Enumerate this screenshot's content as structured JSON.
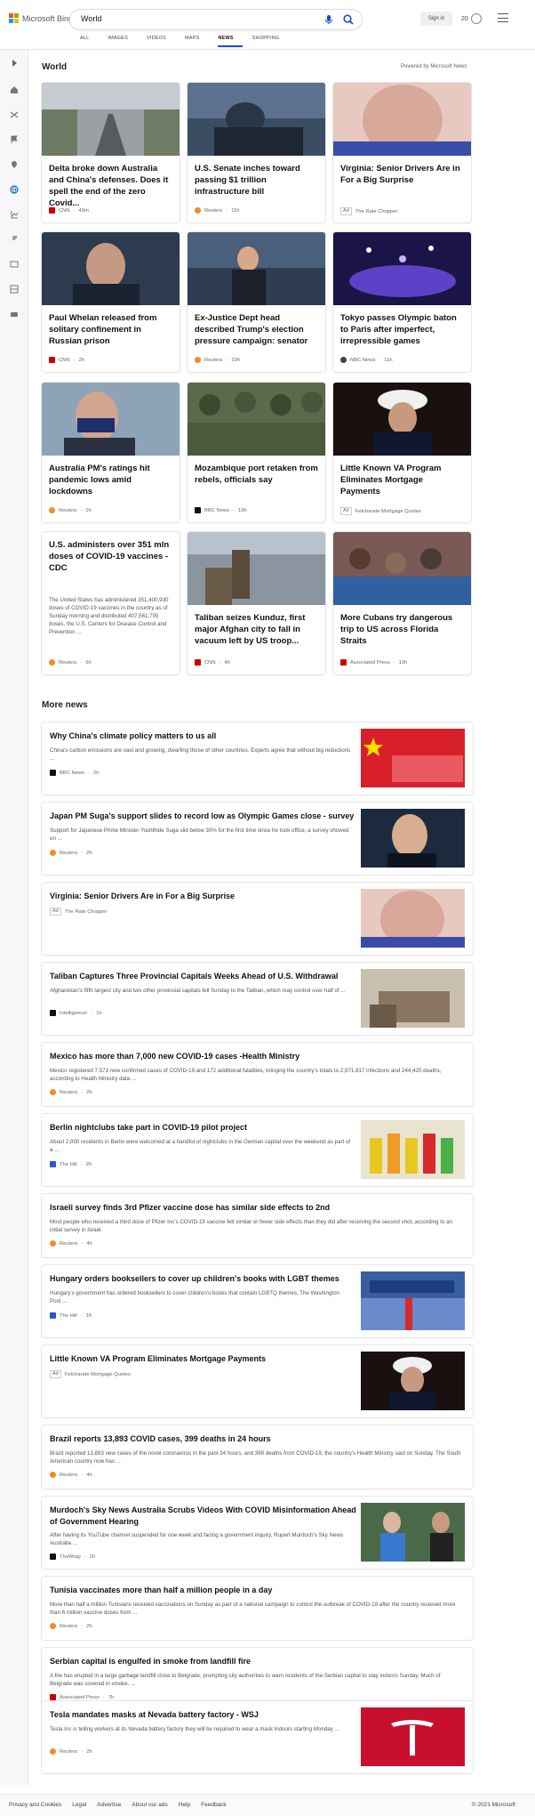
{
  "header": {
    "brand": "Microsoft Bing",
    "query": "World",
    "sign_in": "Sign in",
    "rewards_count": "20",
    "scopes": [
      "ALL",
      "IMAGES",
      "VIDEOS",
      "MAPS",
      "NEWS",
      "SHOPPING"
    ],
    "active_scope": "NEWS"
  },
  "colors": {
    "accent": "#174ae4",
    "brand_red": "#f25022",
    "brand_green": "#7fba00",
    "brand_blue": "#00a4ef",
    "brand_yellow": "#ffb900"
  },
  "rail_icons": [
    "expand-icon",
    "home-icon",
    "shuffle-icon",
    "flag-icon",
    "location-icon",
    "globe-icon",
    "business-icon",
    "rocket-icon",
    "entertainment-icon",
    "sports-icon",
    "car-icon"
  ],
  "world": {
    "title": "World",
    "powered_by": "Powered by Microsoft News",
    "cards": [
      {
        "title": "Delta broke down Australia and China's defenses. Does it spell the end of the zero Covid...",
        "source": "CNN",
        "time": "45m",
        "ad": false
      },
      {
        "title": "U.S. Senate inches toward passing $1 trillion infrastructure bill",
        "source": "Reuters",
        "time": "11h",
        "ad": false
      },
      {
        "title": "Virginia: Senior Drivers Are in For a Big Surprise",
        "source": "The Rate Chopper",
        "time": "",
        "ad": true
      },
      {
        "title": "Paul Whelan released from solitary confinement in Russian prison",
        "source": "CNN",
        "time": "2h",
        "ad": false
      },
      {
        "title": "Ex-Justice Dept head described Trump's election pressure campaign: senator",
        "source": "Reuters",
        "time": "10h",
        "ad": false
      },
      {
        "title": "Tokyo passes Olympic baton to Paris after imperfect, irrepressible games",
        "source": "NBC News",
        "time": "11h",
        "ad": false
      },
      {
        "title": "Australia PM's ratings hit pandemic lows amid lockdowns",
        "source": "Reuters",
        "time": "1h",
        "ad": false
      },
      {
        "title": "Mozambique port retaken from rebels, officials say",
        "source": "BBC News",
        "time": "10h",
        "ad": false
      },
      {
        "title": "Little Known VA Program Eliminates Mortgage Payments",
        "source": "Fetcharate Mortgage Quotes",
        "time": "",
        "ad": true
      },
      {
        "title": "U.S. administers over 351 mln doses of COVID-19 vaccines - CDC",
        "summary": "The United States has administered 351,400,930 doses of COVID-19 vaccines in the country as of Sunday morning and distributed 407,561,705 doses, the U.S. Centers for Disease Control and Prevention ...",
        "source": "Reuters",
        "time": "6h",
        "ad": false
      },
      {
        "title": "Taliban seizes Kunduz, first major Afghan city to fall in vacuum left by US troop...",
        "source": "CNN",
        "time": "4h",
        "ad": false
      },
      {
        "title": "More Cubans try dangerous trip to US across Florida Straits",
        "source": "Associated Press",
        "time": "10h",
        "ad": false
      }
    ]
  },
  "more_news": {
    "title": "More news",
    "items": [
      {
        "title": "Why China's climate policy matters to us all",
        "summary": "China's carbon emissions are vast and growing, dwarfing those of other countries. Experts agree that without big reductions ...",
        "source": "BBC News",
        "time": "2h",
        "ad": false
      },
      {
        "title": "Japan PM Suga's support slides to record low as Olympic Games close - survey",
        "summary": "Support for Japanese Prime Minister Yoshihide Suga slid below 30% for the first time since he took office, a survey showed on ...",
        "source": "Reuters",
        "time": "2h",
        "ad": false
      },
      {
        "title": "Virginia: Senior Drivers Are in For a Big Surprise",
        "summary": "",
        "source": "The Rate Chopper",
        "time": "",
        "ad": true
      },
      {
        "title": "Taliban Captures Three Provincial Capitals Weeks Ahead of U.S. Withdrawal",
        "summary": "Afghanistan's fifth largest city and two other provincial capitals fell Sunday to the Taliban, which may control over half of ...",
        "source": "Intelligencer",
        "time": "1h",
        "ad": false
      },
      {
        "title": "Mexico has more than 7,000 new COVID-19 cases -Health Ministry",
        "summary": "Mexico registered 7,573 new confirmed cases of COVID-19 and 172 additional fatalities, bringing the country's totals to 2,971,817 infections and 244,420 deaths, according to Health Ministry data ...",
        "source": "Reuters",
        "time": "2h",
        "ad": false
      },
      {
        "title": "Berlin nightclubs take part in COVID-19 pilot project",
        "summary": "About 2,000 residents in Berlin were welcomed at a handful of nightclubs in the German capital over the weekend as part of a ...",
        "source": "The Hill",
        "time": "2h",
        "ad": false
      },
      {
        "title": "Israeli survey finds 3rd Pfizer vaccine dose has similar side effects to 2nd",
        "summary": "Most people who received a third dose of Pfizer Inc's COVID-19 vaccine felt similar or fewer side effects than they did after receiving the second shot, according to an initial survey in Israel.",
        "source": "Reuters",
        "time": "4h",
        "ad": false
      },
      {
        "title": "Hungary orders booksellers to cover up children's books with LGBT themes",
        "summary": "Hungary's government has ordered booksellers to cover children's books that contain LGBTQ themes, The Washington Post ...",
        "source": "The Hill",
        "time": "1h",
        "ad": false
      },
      {
        "title": "Little Known VA Program Eliminates Mortgage Payments",
        "summary": "",
        "source": "Fetcharate Mortgage Quotes",
        "time": "",
        "ad": true
      },
      {
        "title": "Brazil reports 13,893 COVID cases, 399 deaths in 24 hours",
        "summary": "Brazil reported 13,893 new cases of the novel coronavirus in the past 24 hours, and 399 deaths from COVID-19, the country's Health Ministry said on Sunday. The South American country now has ...",
        "source": "Reuters",
        "time": "4h",
        "ad": false
      },
      {
        "title": "Murdoch's Sky News Australia Scrubs Videos With COVID Misinformation Ahead of Government Hearing",
        "summary": "After having its YouTube channel suspended for one week and facing a government inquiry, Rupert Murdoch's Sky News Australia ...",
        "source": "TheWrap",
        "time": "2h",
        "ad": false
      },
      {
        "title": "Tunisia vaccinates more than half a million people in a day",
        "summary": "More than half a million Tunisians received vaccinations on Sunday as part of a national campaign to control the outbreak of COVID-19 after the country received more than 6 million vaccine doses from ...",
        "source": "Reuters",
        "time": "2h",
        "ad": false
      },
      {
        "title": "Serbian capital is engulfed in smoke from landfill fire",
        "summary": "A fire has erupted in a large garbage landfill close to Belgrade, prompting city authorities to warn residents of the Serbian capital to stay indoors Sunday. Much of Belgrade was covered in smoke, ...",
        "source": "Associated Press",
        "time": "7h",
        "ad": false
      },
      {
        "title": "Tesla mandates masks at Nevada battery factory - WSJ",
        "summary": "Tesla Inc is telling workers at its Nevada battery factory they will be required to wear a mask indoors starting Monday ...",
        "source": "Reuters",
        "time": "2h",
        "ad": false
      }
    ]
  },
  "ad_label": "Ad",
  "footer": {
    "links": [
      "Privacy and Cookies",
      "Legal",
      "Advertise",
      "About our ads",
      "Help",
      "Feedback"
    ],
    "copyright": "© 2021 Microsoft"
  }
}
